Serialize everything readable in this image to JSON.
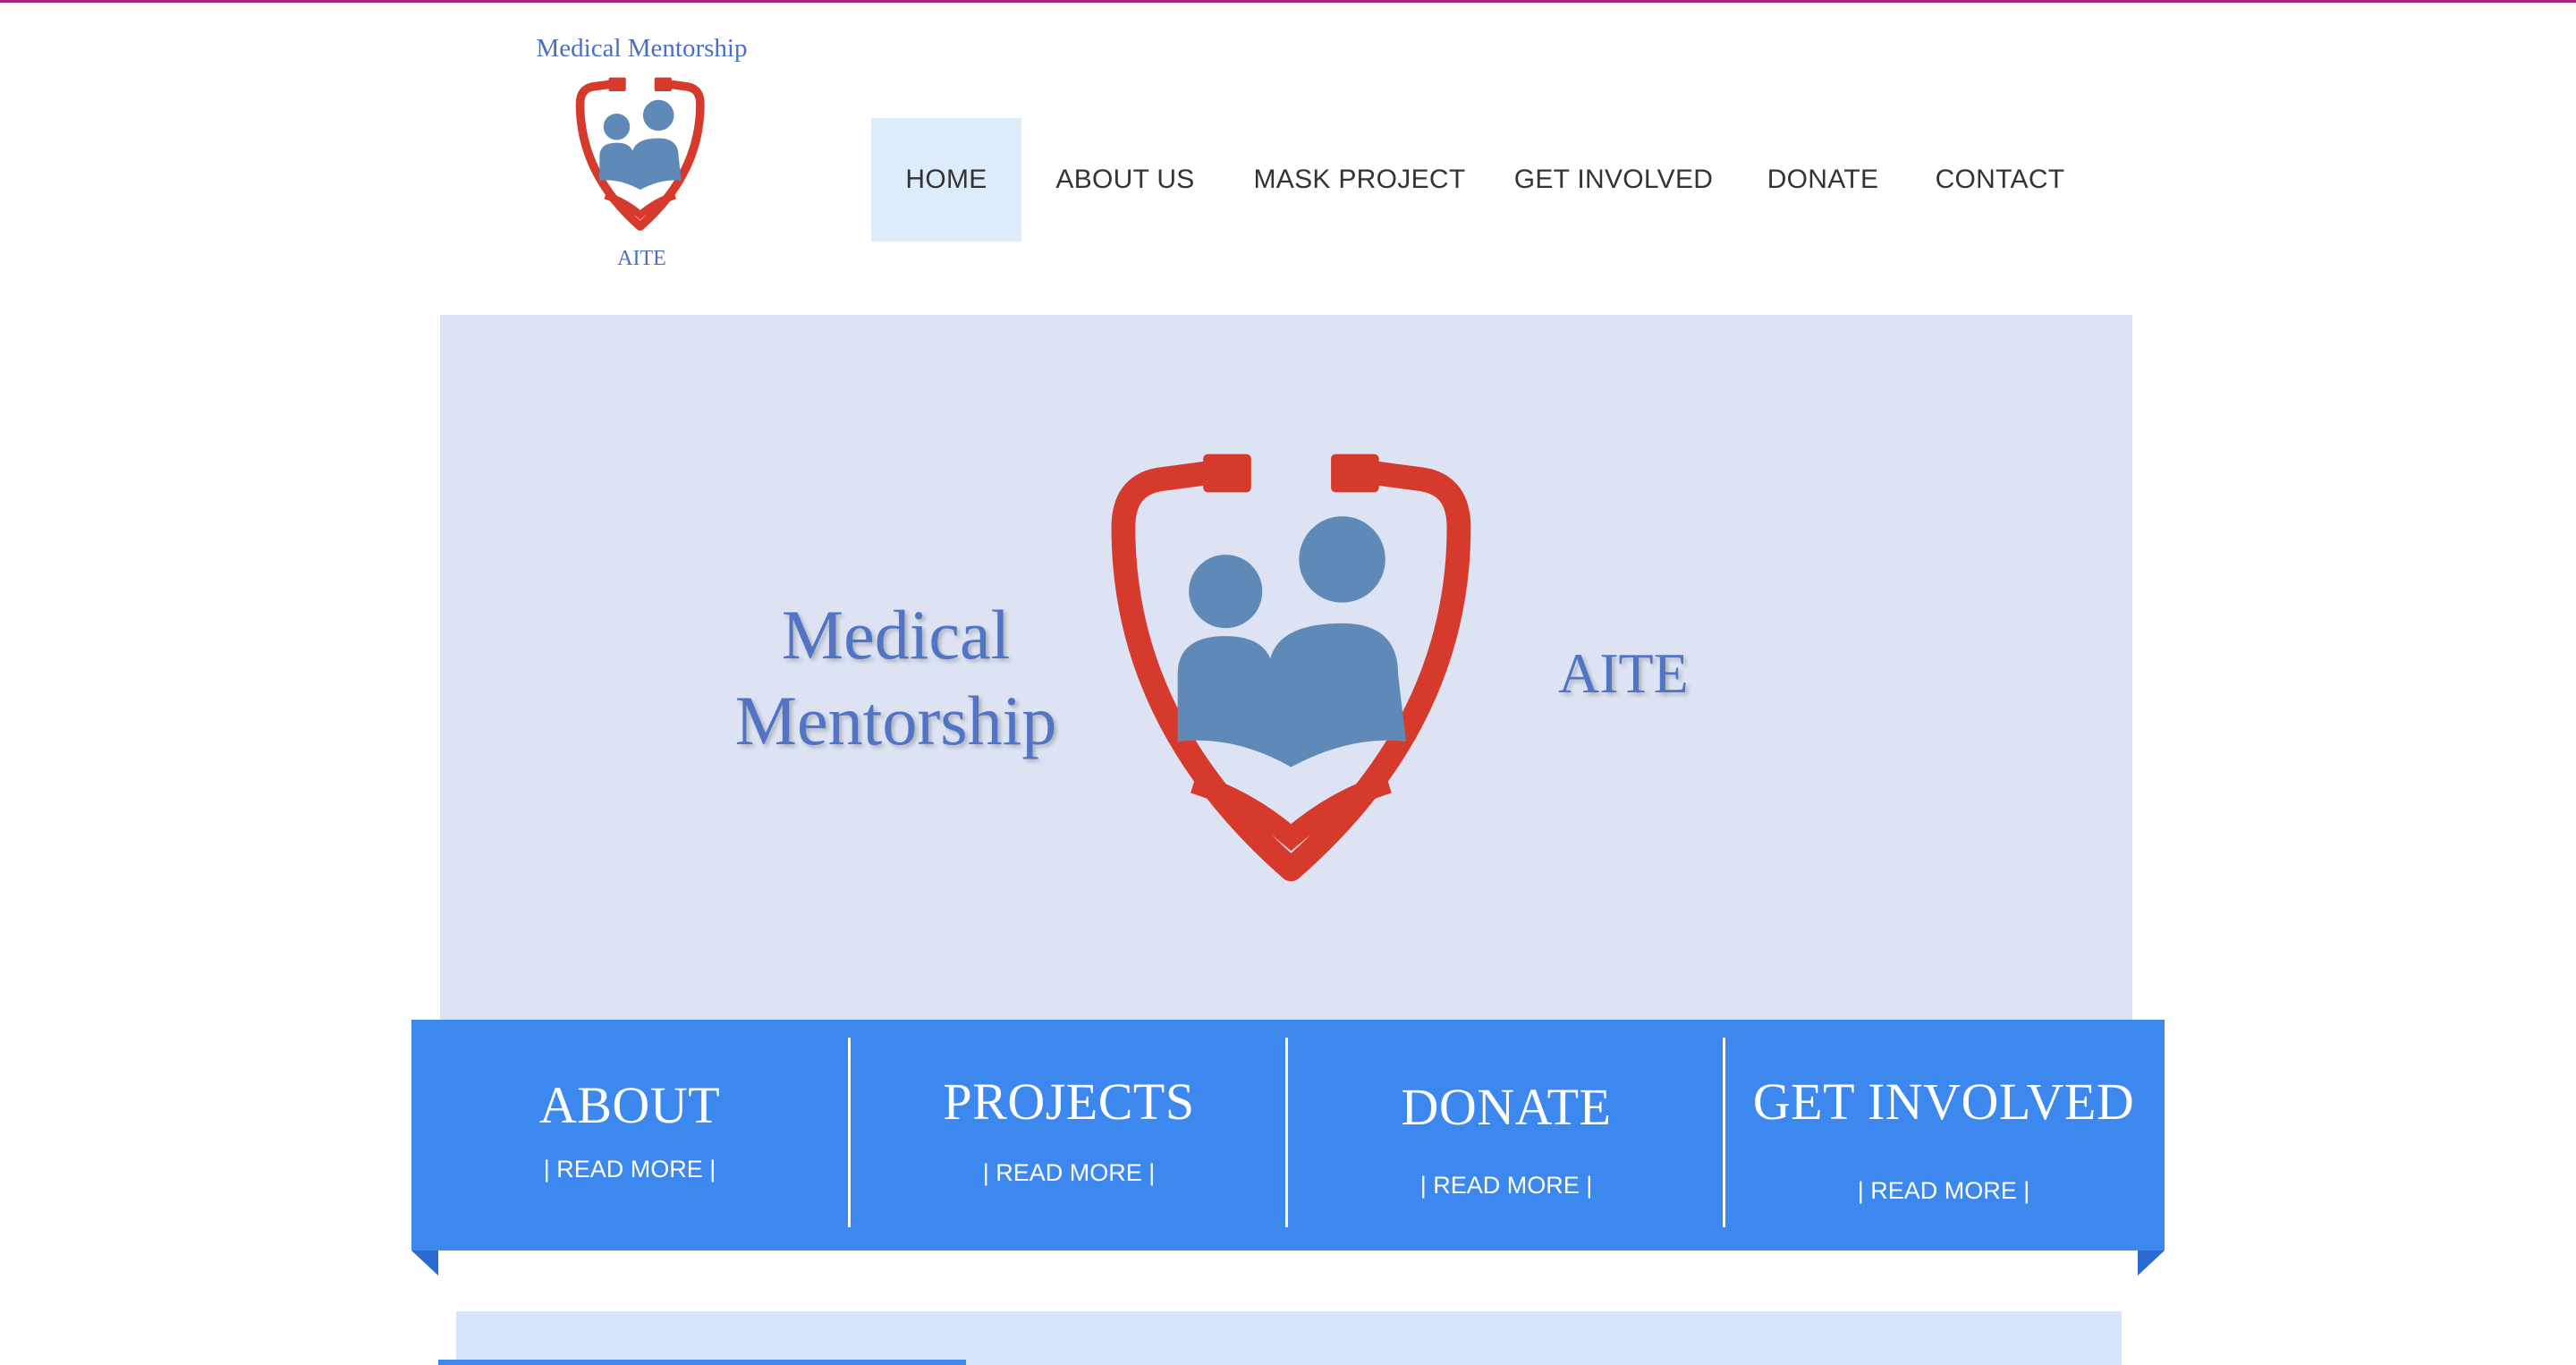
{
  "logo": {
    "title": "Medical Mentorship",
    "subtitle": "AITE"
  },
  "nav": {
    "items": [
      {
        "label": "HOME",
        "active": true
      },
      {
        "label": "ABOUT US"
      },
      {
        "label": "MASK PROJECT"
      },
      {
        "label": "GET INVOLVED"
      },
      {
        "label": "DONATE"
      },
      {
        "label": "CONTACT"
      }
    ]
  },
  "hero": {
    "name_line1": "Medical",
    "name_line2": "Mentorship",
    "aite": "AITE"
  },
  "band": {
    "columns": [
      {
        "title": "ABOUT",
        "link": "| READ MORE |"
      },
      {
        "title": "PROJECTS",
        "link": "| READ MORE |"
      },
      {
        "title": "DONATE",
        "link": "| READ MORE |"
      },
      {
        "title": "GET INVOLVED",
        "link": "| READ MORE |"
      }
    ]
  },
  "colors": {
    "accent_line": "#a3237a",
    "logo_blue": "#5174c4",
    "stethoscope_red": "#d63a2c",
    "people_blue": "#5f89b7",
    "band_blue": "#3d88ef",
    "hero_bg": "#dde3f2",
    "nav_active_bg": "#ddecfb"
  },
  "icons": {
    "logo": "stethoscope-people-logo-icon",
    "hero": "stethoscope-people-emblem-icon"
  }
}
